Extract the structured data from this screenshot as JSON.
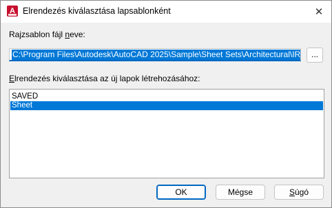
{
  "window": {
    "title": "Elrendezés kiválasztása lapsablonként",
    "app_icon_letter": "A",
    "close_glyph": "✕"
  },
  "template_file": {
    "label_pre": "Rajzsablon fájl ",
    "label_ul": "n",
    "label_post": "eve:",
    "value": "C:\\Program Files\\Autodesk\\AutoCAD 2025\\Sample\\Sheet Sets\\Architectural\\IRD.dwt",
    "browse_label": "..."
  },
  "layout_list": {
    "label_ul": "E",
    "label_post": "lrendezés kiválasztása az új lapok létrehozásához:",
    "items": [
      "SAVED",
      "Sheet"
    ],
    "selected": "Sheet"
  },
  "buttons": {
    "ok": "OK",
    "cancel": "Mégse",
    "help_ul": "S",
    "help_post": "úgó"
  },
  "colors": {
    "accent": "#0078d7",
    "brand": "#c8102e"
  }
}
